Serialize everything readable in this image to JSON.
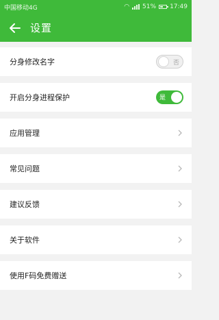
{
  "status_bar": {
    "carrier": "中国移动4G",
    "battery": "51%",
    "time": "17:49",
    "battery_level": 0.51
  },
  "app_bar": {
    "title": "设置",
    "back_icon": "arrow-left-icon"
  },
  "settings": [
    {
      "label": "分身修改名字",
      "control": "toggle",
      "state": "off",
      "toggle_text": "否"
    },
    {
      "label": "开启分身进程保护",
      "control": "toggle",
      "state": "on",
      "toggle_text": "是"
    },
    {
      "label": "应用管理",
      "control": "chevron"
    },
    {
      "label": "常见问题",
      "control": "chevron"
    },
    {
      "label": "建议反馈",
      "control": "chevron"
    },
    {
      "label": "关于软件",
      "control": "chevron"
    },
    {
      "label": "使用F码免费赠送",
      "control": "chevron"
    }
  ],
  "colors": {
    "accent": "#3fba3a",
    "background": "#f2f2f2",
    "row": "#ffffff"
  }
}
